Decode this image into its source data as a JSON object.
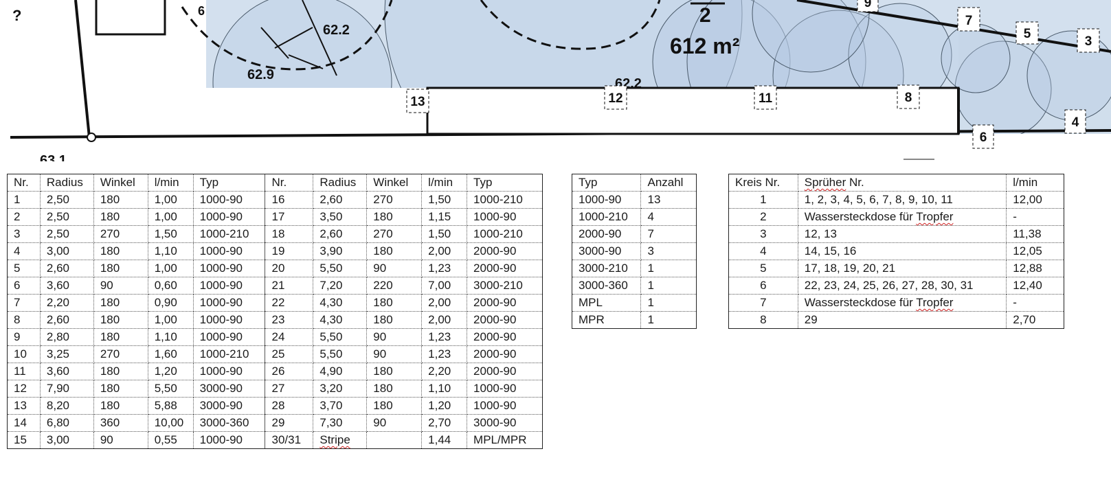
{
  "plan": {
    "labels_measure": [
      "62.2",
      "62.9",
      "6",
      "612 m²",
      "2",
      "62.2",
      "63.1"
    ],
    "sprinkler_markers": [
      "9",
      "7",
      "5",
      "3",
      "13",
      "12",
      "11",
      "8",
      "4",
      "6"
    ]
  },
  "table_sprinklers": {
    "headers": [
      "Nr.",
      "Radius",
      "Winkel",
      "l/min",
      "Typ",
      "Nr.",
      "Radius",
      "Winkel",
      "l/min",
      "Typ"
    ],
    "rows": [
      [
        "1",
        "2,50",
        "180",
        "1,00",
        "1000-90",
        "16",
        "2,60",
        "270",
        "1,50",
        "1000-210"
      ],
      [
        "2",
        "2,50",
        "180",
        "1,00",
        "1000-90",
        "17",
        "3,50",
        "180",
        "1,15",
        "1000-90"
      ],
      [
        "3",
        "2,50",
        "270",
        "1,50",
        "1000-210",
        "18",
        "2,60",
        "270",
        "1,50",
        "1000-210"
      ],
      [
        "4",
        "3,00",
        "180",
        "1,10",
        "1000-90",
        "19",
        "3,90",
        "180",
        "2,00",
        "2000-90"
      ],
      [
        "5",
        "2,60",
        "180",
        "1,00",
        "1000-90",
        "20",
        "5,50",
        "90",
        "1,23",
        "2000-90"
      ],
      [
        "6",
        "3,60",
        "90",
        "0,60",
        "1000-90",
        "21",
        "7,20",
        "220",
        "7,00",
        "3000-210"
      ],
      [
        "7",
        "2,20",
        "180",
        "0,90",
        "1000-90",
        "22",
        "4,30",
        "180",
        "2,00",
        "2000-90"
      ],
      [
        "8",
        "2,60",
        "180",
        "1,00",
        "1000-90",
        "23",
        "4,30",
        "180",
        "2,00",
        "2000-90"
      ],
      [
        "9",
        "2,80",
        "180",
        "1,10",
        "1000-90",
        "24",
        "5,50",
        "90",
        "1,23",
        "2000-90"
      ],
      [
        "10",
        "3,25",
        "270",
        "1,60",
        "1000-210",
        "25",
        "5,50",
        "90",
        "1,23",
        "2000-90"
      ],
      [
        "11",
        "3,60",
        "180",
        "1,20",
        "1000-90",
        "26",
        "4,90",
        "180",
        "2,20",
        "2000-90"
      ],
      [
        "12",
        "7,90",
        "180",
        "5,50",
        "3000-90",
        "27",
        "3,20",
        "180",
        "1,10",
        "1000-90"
      ],
      [
        "13",
        "8,20",
        "180",
        "5,88",
        "3000-90",
        "28",
        "3,70",
        "180",
        "1,20",
        "1000-90"
      ],
      [
        "14",
        "6,80",
        "360",
        "10,00",
        "3000-360",
        "29",
        "7,30",
        "90",
        "2,70",
        "3000-90"
      ],
      [
        "15",
        "3,00",
        "90",
        "0,55",
        "1000-90",
        "30/31",
        "Stripe",
        "",
        "1,44",
        "MPL/MPR"
      ]
    ]
  },
  "table_types": {
    "headers": [
      "Typ",
      "Anzahl"
    ],
    "rows": [
      [
        " 1000-90",
        "13"
      ],
      [
        "1000-210",
        "4"
      ],
      [
        "2000-90",
        "7"
      ],
      [
        "3000-90",
        "3"
      ],
      [
        "3000-210",
        "1"
      ],
      [
        "3000-360",
        "1"
      ],
      [
        "MPL",
        "1"
      ],
      [
        "MPR",
        "1"
      ]
    ]
  },
  "table_circuits": {
    "headers": [
      "Kreis Nr.",
      "Sprüher Nr.",
      "l/min"
    ],
    "rows": [
      [
        "1",
        "1, 2, 3, 4, 5, 6, 7, 8, 9, 10, 11",
        "12,00"
      ],
      [
        "2",
        "Wassersteckdose für Tropfer",
        "-"
      ],
      [
        "3",
        "12, 13",
        "11,38"
      ],
      [
        "4",
        "14, 15, 16",
        "12,05"
      ],
      [
        "5",
        "17, 18, 19, 20, 21",
        "12,88"
      ],
      [
        "6",
        "22, 23, 24, 25, 26, 27, 28, 30, 31",
        "12,40"
      ],
      [
        "7",
        "Wassersteckdose für Tropfer",
        "-"
      ],
      [
        "8",
        "29",
        "2,70"
      ]
    ]
  },
  "colors": {
    "coverage_fill": "#c9d8ea",
    "coverage_stroke": "#4a5a6a",
    "line": "#111111"
  }
}
